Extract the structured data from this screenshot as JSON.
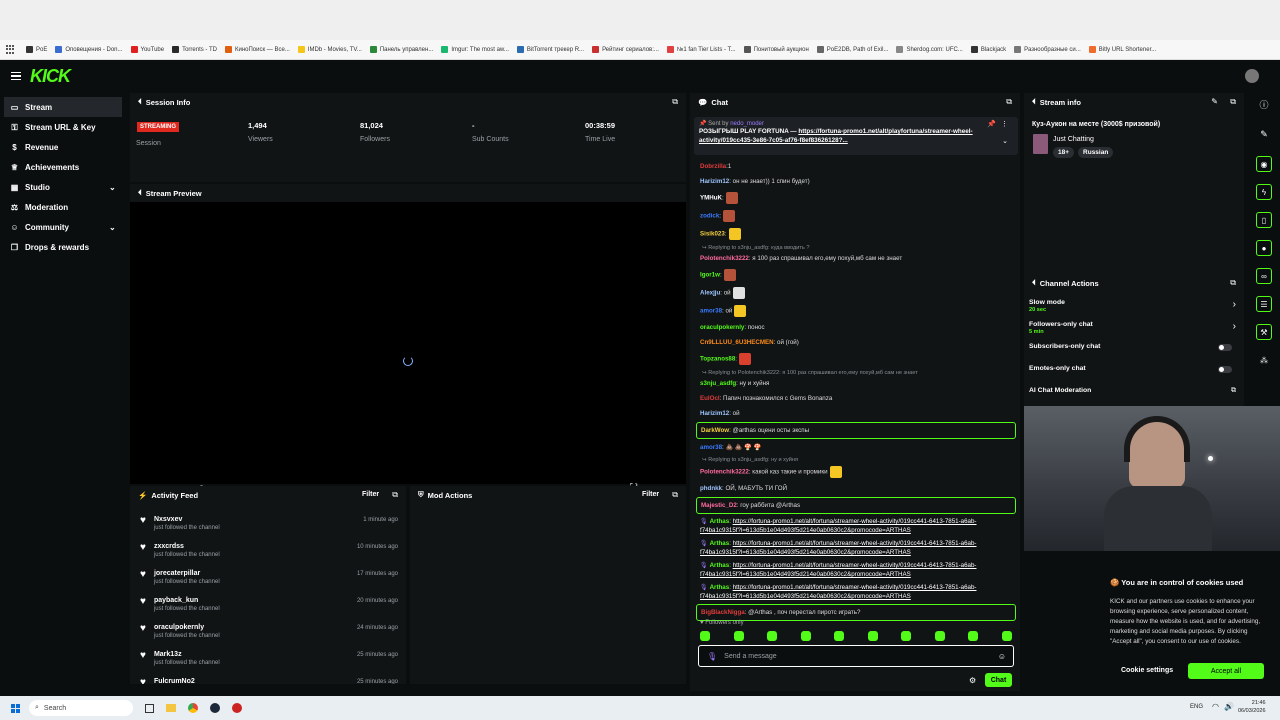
{
  "bookmarks": [
    "PoE",
    "Оповещения - Don...",
    "YouTube",
    "Torrents - TD",
    "КиноПоиск — Все...",
    "IMDb - Movies, TV...",
    "Панель управлен...",
    "Imgur: The most aw...",
    "BitTorrent трекер R...",
    "Рейтинг сериалов:...",
    "№1 fan Tier Lists - T...",
    "Понитовый аукцион",
    "PoE2DB, Path of Exil...",
    "Sherdog.com: UFC...",
    "Blackjack",
    "Разнообразные си...",
    "Bitly URL Shortener..."
  ],
  "brand": {
    "logo": "KICK",
    "accent": "#53fc18"
  },
  "sidebar": {
    "items": [
      {
        "label": "Stream",
        "icon": "stream-icon"
      },
      {
        "label": "Stream URL & Key",
        "icon": "key-icon"
      },
      {
        "label": "Revenue",
        "icon": "dollar-icon"
      },
      {
        "label": "Achievements",
        "icon": "trophy-icon"
      },
      {
        "label": "Studio",
        "icon": "studio-icon"
      },
      {
        "label": "Moderation",
        "icon": "gavel-icon"
      },
      {
        "label": "Community",
        "icon": "people-icon"
      },
      {
        "label": "Drops & rewards",
        "icon": "gift-icon"
      }
    ]
  },
  "session": {
    "title": "Session Info",
    "badge": "STREAMING",
    "stats": [
      {
        "value": "1,494",
        "label": "Viewers"
      },
      {
        "value": "81,024",
        "label": "Followers"
      },
      {
        "value": "-",
        "label": "Sub Counts"
      },
      {
        "value": "00:38:59",
        "label": "Time Live"
      }
    ],
    "session_label": "Session"
  },
  "preview": {
    "title": "Stream Preview"
  },
  "activity": {
    "title": "Activity Feed",
    "filter": "Filter",
    "items": [
      {
        "name": "Nxsvxev",
        "sub": "just followed the channel",
        "time": "1 minute ago"
      },
      {
        "name": "zxxcrdss",
        "sub": "just followed the channel",
        "time": "10 minutes ago"
      },
      {
        "name": "jorecaterpillar",
        "sub": "just followed the channel",
        "time": "17 minutes ago"
      },
      {
        "name": "payback_kun",
        "sub": "just followed the channel",
        "time": "20 minutes ago"
      },
      {
        "name": "oraculpokernly",
        "sub": "just followed the channel",
        "time": "24 minutes ago"
      },
      {
        "name": "Mark13z",
        "sub": "just followed the channel",
        "time": "25 minutes ago"
      },
      {
        "name": "FulcrumNo2",
        "sub": "",
        "time": "25 minutes ago"
      }
    ]
  },
  "modactions": {
    "title": "Mod Actions",
    "filter": "Filter"
  },
  "chat": {
    "title": "Chat",
    "pinned": {
      "sent_by": "Sent by",
      "author": "nedo_moder",
      "text": "РОЗЫГРЫШ PLAY FORTUNA — ",
      "link": "https://fortuna-promo1.net/alt/playfortuna/streamer-wheel-activity/019cc435-3e86-7c05-af76-f8ef83626128?..."
    },
    "messages": [
      {
        "user": "Dobrzilla",
        "color": "#e03c3c",
        "text": ":1"
      },
      {
        "user": "Harizim12",
        "color": "#9ec5ff",
        "text": ": он не знает)) 1 спин будет)"
      },
      {
        "user": "YMHuK",
        "color": "#ffffff",
        "text": ":",
        "emote": "#b5523a"
      },
      {
        "user": "zodick",
        "color": "#3a7bff",
        "text": ":",
        "emote": "#b5523a"
      },
      {
        "user": "Sisik023",
        "color": "#f4d03f",
        "text": ":",
        "emote": "#f3c623"
      },
      {
        "reply": "Replying to s3nju_asdfg: куда вводить ?"
      },
      {
        "user": "Polotenchik3222",
        "color": "#ff6b9d",
        "text": ": я 100 раз спрашивал его,ему похуй,мб сам не знает"
      },
      {
        "user": "Igor1w",
        "color": "#53fc18",
        "text": ":",
        "emote": "#b5523a"
      },
      {
        "user": "Alexjju",
        "color": "#9ec5ff",
        "text": ": ой",
        "emote": "#e0e0e0"
      },
      {
        "user": "amor38",
        "color": "#3a7bff",
        "text": ": ой",
        "emote": "#f3c623"
      },
      {
        "user": "oraculpokernly",
        "color": "#53fc18",
        "text": ": понос"
      },
      {
        "user": "Cn9LLLUU_6U3HECMEN",
        "color": "#ff8c1a",
        "text": ": ой (гой)"
      },
      {
        "user": "Topzanos88",
        "color": "#53fc18",
        "text": ":",
        "emote": "#d9412e"
      },
      {
        "reply": "Replying to Polotenchik3222: я 100 раз спрашивал его,ему похуй,мб сам не знает"
      },
      {
        "user": "s3nju_asdfg",
        "color": "#53fc18",
        "text": ": ну и хуйня"
      },
      {
        "user": "EulOcl",
        "color": "#e03c3c",
        "text": ": Папич познакомился с Gems Bonanza"
      },
      {
        "user": "Harizim12",
        "color": "#9ec5ff",
        "text": ": ой"
      },
      {
        "user": "DarkWow",
        "color": "#f4d03f",
        "text": ": @arthas оцени осты экспы",
        "hl": true
      },
      {
        "user": "amor38",
        "color": "#3a7bff",
        "text": ": 💩 💩 🍄 🍄"
      },
      {
        "reply": "Replying to s3nju_asdfg: ну и хуйня"
      },
      {
        "user": "Polotenchik3222",
        "color": "#ff6b9d",
        "text": ": какой каз такие и промики",
        "emote": "#f3c623"
      },
      {
        "user": "phdnkk",
        "color": "#9ec5ff",
        "text": ": ОЙ, МАБУТЬ ТИ ГОЙ"
      },
      {
        "user": "Majestic_D2",
        "color": "#ff6b9d",
        "text": ": гоу раббита @Arthas",
        "hl": true
      },
      {
        "user": "Arthas",
        "color": "#53fc18",
        "link": "https://fortuna-promo1.net/alt/fortuna/streamer-wheel-activity/019cc441-6413-7851-a6ab-f74ba1c9315f?l=613d5b1e04d493f5d214e0ab0630c2&promocode=ARTHAS"
      },
      {
        "user": "Arthas",
        "color": "#53fc18",
        "link": "https://fortuna-promo1.net/alt/fortuna/streamer-wheel-activity/019cc441-6413-7851-a6ab-f74ba1c9315f?l=613d5b1e04d493f5d214e0ab0630c2&promocode=ARTHAS"
      },
      {
        "user": "Arthas",
        "color": "#53fc18",
        "link": "https://fortuna-promo1.net/alt/fortuna/streamer-wheel-activity/019cc441-6413-7851-a6ab-f74ba1c9315f?l=613d5b1e04d493f5d214e0ab0630c2&promocode=ARTHAS"
      },
      {
        "user": "Arthas",
        "color": "#53fc18",
        "link": "https://fortuna-promo1.net/alt/fortuna/streamer-wheel-activity/019cc441-6413-7851-a6ab-f74ba1c9315f?l=613d5b1e04d493f5d214e0ab0630c2&promocode=ARTHAS"
      },
      {
        "user": "BigBlackNigga",
        "color": "#e03c3c",
        "text": ": @Arthas , поч перестал пиротс играть?",
        "hl": true
      }
    ],
    "followers_only": "Followers only",
    "placeholder": "Send a message",
    "send": "Chat"
  },
  "streaminfo": {
    "title": "Stream info",
    "stream_title": "Куз-Аукон на месте (3000$ призовой)",
    "category": "Just Chatting",
    "tags": [
      "18+",
      "Russian"
    ]
  },
  "channel_actions": {
    "title": "Channel Actions",
    "items": [
      {
        "label": "Slow mode",
        "sub": "20 sec",
        "type": "arrow"
      },
      {
        "label": "Followers-only chat",
        "sub": "5 min",
        "type": "arrow"
      },
      {
        "label": "Subscribers-only chat",
        "sub": "",
        "type": "toggle"
      },
      {
        "label": "Emotes-only chat",
        "sub": "",
        "type": "toggle"
      },
      {
        "label": "AI Chat Moderation",
        "sub": "",
        "type": "link"
      }
    ]
  },
  "cookies": {
    "title": "You are in control of cookies used",
    "body": "KICK and our partners use cookies to enhance your browsing experience, serve personalized content, measure how the website is used, and for advertising, marketing and social media purposes. By clicking \"Accept all\", you consent to our use of cookies.",
    "settings": "Cookie settings",
    "accept": "Accept all"
  },
  "taskbar": {
    "search": "Search",
    "lang": "ENG",
    "time": "21:46",
    "date": "06/03/2026"
  }
}
